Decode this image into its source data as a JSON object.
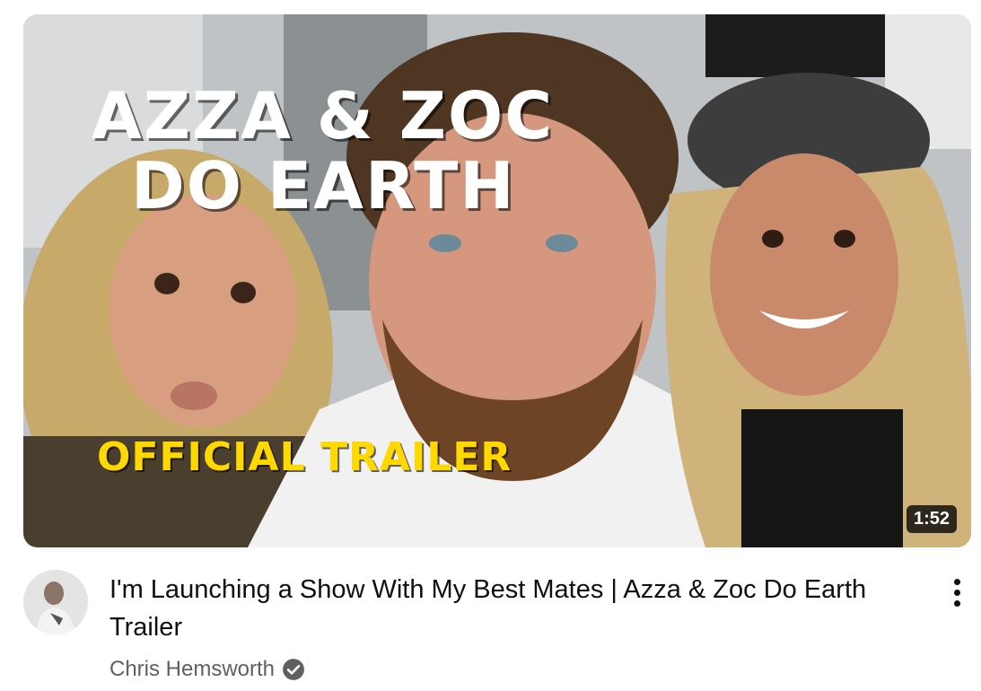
{
  "video": {
    "thumbnail": {
      "overlay_title_line1": "AZZA & ZOC",
      "overlay_title_line2": "DO EARTH",
      "overlay_subtitle": "OFFICIAL TRAILER",
      "duration": "1:52"
    },
    "title": "I'm Launching a Show With My Best Mates | Azza & Zoc Do Earth Trailer",
    "channel": {
      "name": "Chris Hemsworth",
      "verified": true,
      "avatar_icon": "channel-avatar"
    },
    "menu_icon": "more-vertical-icon"
  },
  "colors": {
    "overlay_subtitle": "#ffd800",
    "title_text": "#0f0f0f",
    "channel_text": "#606060",
    "duration_bg": "#000000"
  }
}
